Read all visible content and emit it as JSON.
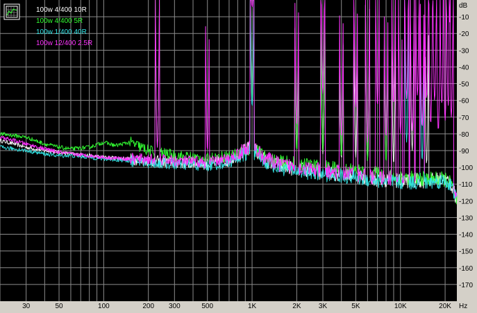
{
  "colors": {
    "background": "#000000",
    "frame": "#d4d0c8",
    "grid": "#8c8c8c",
    "white_series": "#ffffff",
    "green_series": "#33ff33",
    "cyan_series": "#33e6e6",
    "magenta_series": "#ff33ff"
  },
  "toolbar": {
    "legend_toggle_icon": "graph-icon"
  },
  "chart_data": {
    "type": "line",
    "title": "",
    "xlabel": "Hz",
    "ylabel": "dB",
    "xscale": "log",
    "xlim": [
      20,
      24000
    ],
    "ylim": [
      -180,
      0
    ],
    "grid": true,
    "legend": "top-left",
    "x_ticks": [
      {
        "v": 30,
        "t": "30"
      },
      {
        "v": 50,
        "t": "50"
      },
      {
        "v": 100,
        "t": "100"
      },
      {
        "v": 200,
        "t": "200"
      },
      {
        "v": 300,
        "t": "300"
      },
      {
        "v": 500,
        "t": "500"
      },
      {
        "v": 1000,
        "t": "1K"
      },
      {
        "v": 2000,
        "t": "2K"
      },
      {
        "v": 3000,
        "t": "3K"
      },
      {
        "v": 5000,
        "t": "5K"
      },
      {
        "v": 10000,
        "t": "10K"
      },
      {
        "v": 20000,
        "t": "20K"
      }
    ],
    "x_unit": "Hz",
    "y_ticks": [
      -10,
      -20,
      -30,
      -40,
      -50,
      -60,
      -70,
      -80,
      -90,
      -100,
      -110,
      -120,
      -130,
      -140,
      -150,
      -160,
      -170
    ],
    "y_unit": "dB",
    "series": [
      {
        "name": "100w 4/400 10R",
        "color": "#ffffff",
        "x": [
          20,
          25,
          30,
          40,
          50,
          60,
          80,
          100,
          150,
          200,
          300,
          500,
          700,
          900,
          1000,
          1200,
          1500,
          2000,
          3000,
          5000,
          7000,
          10000,
          15000,
          20000,
          22000,
          24000
        ],
        "y": [
          -84,
          -86,
          -88,
          -90,
          -91,
          -92,
          -93,
          -94,
          -95,
          -96,
          -97,
          -98,
          -96,
          -90,
          -88,
          -95,
          -99,
          -101,
          -103,
          -105,
          -107,
          -108,
          -108,
          -107,
          -110,
          -120
        ],
        "peaks": [
          {
            "x": 1000,
            "y": -62
          },
          {
            "x": 2000,
            "y": -90
          },
          {
            "x": 3000,
            "y": -92
          },
          {
            "x": 4000,
            "y": -95
          },
          {
            "x": 5000,
            "y": -94
          },
          {
            "x": 6000,
            "y": -96
          },
          {
            "x": 9000,
            "y": -98
          },
          {
            "x": 12000,
            "y": -90
          },
          {
            "x": 15000,
            "y": -98
          }
        ]
      },
      {
        "name": "100w 4/400 5R",
        "color": "#33ff33",
        "x": [
          20,
          25,
          30,
          40,
          50,
          60,
          80,
          100,
          120,
          150,
          200,
          300,
          500,
          700,
          900,
          1000,
          1200,
          1500,
          2000,
          3000,
          5000,
          7000,
          10000,
          15000,
          20000,
          22000,
          24000
        ],
        "y": [
          -80,
          -81,
          -82,
          -86,
          -88,
          -89,
          -88,
          -85,
          -87,
          -85,
          -90,
          -93,
          -95,
          -93,
          -90,
          -88,
          -94,
          -97,
          -98,
          -100,
          -102,
          -104,
          -106,
          -107,
          -107,
          -110,
          -121
        ],
        "peaks": [
          {
            "x": 230,
            "y": -88
          },
          {
            "x": 1000,
            "y": -60
          },
          {
            "x": 2000,
            "y": -90
          },
          {
            "x": 3000,
            "y": -90
          },
          {
            "x": 4000,
            "y": -94
          },
          {
            "x": 6000,
            "y": -96
          },
          {
            "x": 8000,
            "y": -97
          }
        ]
      },
      {
        "name": "100w 1/400 40R",
        "color": "#33e6e6",
        "x": [
          20,
          25,
          30,
          40,
          50,
          60,
          80,
          100,
          150,
          200,
          300,
          500,
          700,
          900,
          1000,
          1200,
          1500,
          2000,
          3000,
          5000,
          7000,
          10000,
          15000,
          20000,
          22000,
          24000
        ],
        "y": [
          -88,
          -89,
          -90,
          -92,
          -93,
          -93,
          -94,
          -95,
          -96,
          -97,
          -98,
          -99,
          -97,
          -92,
          -90,
          -96,
          -100,
          -102,
          -104,
          -106,
          -108,
          -109,
          -109,
          -108,
          -111,
          -119
        ],
        "peaks": [
          {
            "x": 1000,
            "y": -64
          },
          {
            "x": 11000,
            "y": -85
          },
          {
            "x": 14000,
            "y": -96
          }
        ]
      },
      {
        "name": "100w 12/400 2.5R",
        "color": "#ff33ff",
        "x": [
          20,
          25,
          30,
          40,
          50,
          60,
          80,
          100,
          150,
          200,
          300,
          500,
          700,
          900,
          1000,
          1200,
          1500,
          2000,
          3000,
          5000,
          7000,
          10000,
          15000,
          20000,
          22000,
          24000
        ],
        "y": [
          -82,
          -84,
          -86,
          -89,
          -91,
          -92,
          -93,
          -94,
          -95,
          -95,
          -96,
          -97,
          -95,
          -89,
          -87,
          -94,
          -98,
          -100,
          -102,
          -104,
          -106,
          -107,
          -107,
          -106,
          -108,
          -120
        ],
        "peaks": [
          {
            "x": 230,
            "y": -88
          },
          {
            "x": 500,
            "y": -90
          },
          {
            "x": 1000,
            "y": -5
          },
          {
            "x": 2000,
            "y": -75
          },
          {
            "x": 3000,
            "y": -56
          },
          {
            "x": 4000,
            "y": -82
          },
          {
            "x": 5000,
            "y": -64
          },
          {
            "x": 6000,
            "y": -85
          },
          {
            "x": 7000,
            "y": -63
          },
          {
            "x": 8000,
            "y": -82
          },
          {
            "x": 9000,
            "y": -62
          },
          {
            "x": 10000,
            "y": -80
          },
          {
            "x": 11000,
            "y": -59
          },
          {
            "x": 12000,
            "y": -78
          },
          {
            "x": 13000,
            "y": -57
          },
          {
            "x": 14000,
            "y": -76
          },
          {
            "x": 15000,
            "y": -59
          },
          {
            "x": 16000,
            "y": -74
          },
          {
            "x": 17000,
            "y": -60
          },
          {
            "x": 18000,
            "y": -78
          },
          {
            "x": 19000,
            "y": -62
          },
          {
            "x": 20000,
            "y": -72
          },
          {
            "x": 21000,
            "y": -63
          },
          {
            "x": 22000,
            "y": -70
          }
        ]
      }
    ]
  }
}
